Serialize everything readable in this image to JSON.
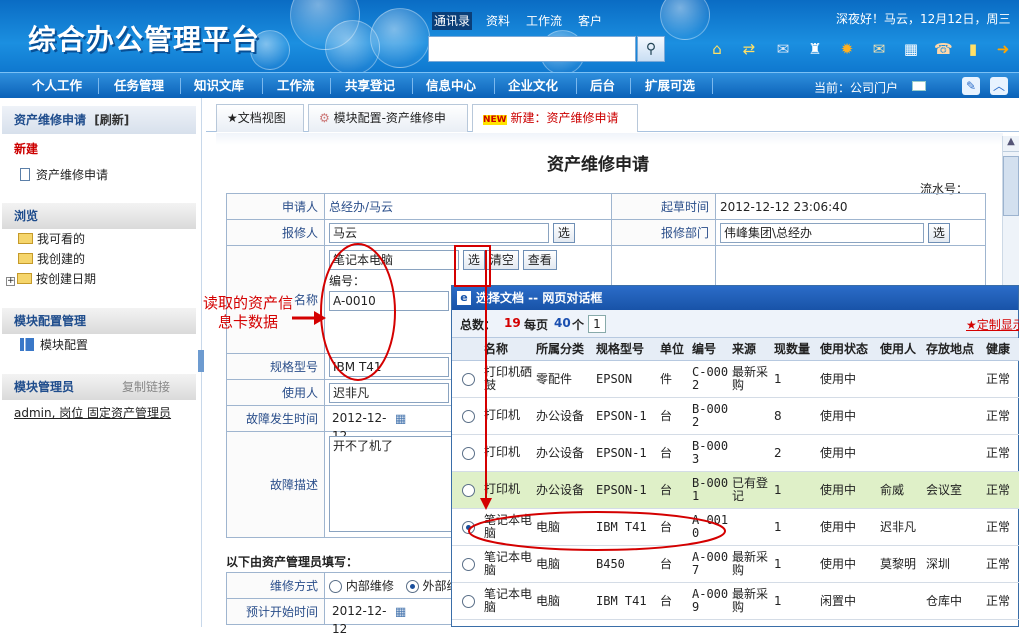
{
  "header": {
    "app_title": "综合办公管理平台",
    "tabs": [
      "通讯录",
      "资料",
      "工作流",
      "客户"
    ],
    "greeting": "深夜好！马云，12月12日，周三",
    "icons": [
      "home-icon",
      "switch-icon",
      "mail-icon",
      "shirt-icon",
      "settings-icon",
      "inbox-icon",
      "calendar-icon",
      "contacts-icon",
      "notes-icon",
      "logout-icon"
    ]
  },
  "nav": {
    "items": [
      "个人工作",
      "任务管理",
      "知识文库",
      "工作流",
      "共享登记",
      "信息中心",
      "企业文化",
      "后台",
      "扩展可选"
    ],
    "current": "当前：公司门户"
  },
  "sidebar": {
    "title": "资产维修申请",
    "refresh": "[刷新]",
    "new_heading": "新建",
    "new_item": "资产维修申请",
    "browse_heading": "浏览",
    "browse_items": [
      "我可看的",
      "我创建的",
      "按创建日期"
    ],
    "config_heading": "模块配置管理",
    "config_item": "模块配置",
    "admin_heading": "模块管理员",
    "copy_link": "复制链接",
    "admin_value": "admin, 岗位 固定资产管理员"
  },
  "tabs": {
    "doc_view": "★文档视图",
    "module_config": "模块配置-资产维修申",
    "new_label": "NEW",
    "new_doc": "新建：资产维修申请"
  },
  "form": {
    "title": "资产维修申请",
    "serial_label": "流水号：",
    "applicant_label": "申请人",
    "applicant": "总经办/马云",
    "draft_time_label": "起草时间",
    "draft_time": "2012-12-12 23:06:40",
    "reporter_label": "报修人",
    "reporter": "马云",
    "select_btn": "选",
    "dept_label": "报修部门",
    "dept": "伟峰集团\\总经办",
    "asset_name": "笔记本电脑",
    "name_label": "名称",
    "clear_btn": "清空",
    "view_btn": "查看",
    "code_label": "编号：",
    "code": "A-0010",
    "model_label": "规格型号",
    "model": "IBM T41",
    "user_label": "使用人",
    "user": "迟非凡",
    "fault_time_label": "故障发生时间",
    "fault_time": "2012-12-12",
    "fault_desc_label": "故障描述",
    "fault_desc": "开不了机了",
    "admin_section": "以下由资产管理员填写：",
    "repair_mode_label": "维修方式",
    "internal": "内部维修",
    "external": "外部维",
    "start_time_label": "预计开始时间",
    "start_time": "2012-12-12"
  },
  "annotation": {
    "line1": "读取的资产信",
    "line2": "息卡数据"
  },
  "dialog": {
    "title": "选择文档 -- 网页对话框",
    "total_label": "总数：",
    "total": "19",
    "per_page_label": "每页",
    "per_page": "40",
    "per_page_unit": "个",
    "page": "1",
    "custom": "★定制显示",
    "columns": [
      "名称",
      "所属分类",
      "规格型号",
      "单位",
      "编号",
      "来源",
      "现数量",
      "使用状态",
      "使用人",
      "存放地点",
      "健康"
    ],
    "rows": [
      {
        "name": "打印机硒鼓",
        "cat": "零配件",
        "model": "EPSON",
        "unit": "件",
        "code": "C-0002",
        "src": "最新采购",
        "qty": "1",
        "status": "使用中",
        "user": "",
        "loc": "",
        "health": "正常"
      },
      {
        "name": "打印机",
        "cat": "办公设备",
        "model": "EPSON-1",
        "unit": "台",
        "code": "B-0002",
        "src": "",
        "qty": "8",
        "status": "使用中",
        "user": "",
        "loc": "",
        "health": "正常"
      },
      {
        "name": "打印机",
        "cat": "办公设备",
        "model": "EPSON-1",
        "unit": "台",
        "code": "B-0003",
        "src": "",
        "qty": "2",
        "status": "使用中",
        "user": "",
        "loc": "",
        "health": "正常"
      },
      {
        "name": "打印机",
        "cat": "办公设备",
        "model": "EPSON-1",
        "unit": "台",
        "code": "B-0001",
        "src": "已有登记",
        "qty": "1",
        "status": "使用中",
        "user": "俞威",
        "loc": "会议室",
        "health": "正常"
      },
      {
        "name": "笔记本电脑",
        "cat": "电脑",
        "model": "IBM T41",
        "unit": "台",
        "code": "A-0010",
        "src": "",
        "qty": "1",
        "status": "使用中",
        "user": "迟非凡",
        "loc": "",
        "health": "正常"
      },
      {
        "name": "笔记本电脑",
        "cat": "电脑",
        "model": "B450",
        "unit": "台",
        "code": "A-0007",
        "src": "最新采购",
        "qty": "1",
        "status": "使用中",
        "user": "莫黎明",
        "loc": "深圳",
        "health": "正常"
      },
      {
        "name": "笔记本电脑",
        "cat": "电脑",
        "model": "IBM T41",
        "unit": "台",
        "code": "A-0009",
        "src": "最新采购",
        "qty": "1",
        "status": "闲置中",
        "user": "",
        "loc": "仓库中",
        "health": "正常"
      }
    ]
  }
}
